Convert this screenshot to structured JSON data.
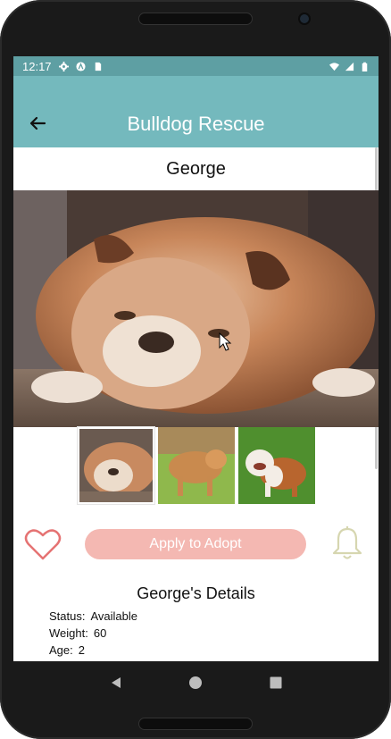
{
  "status_bar": {
    "time": "12:17",
    "left_icons": [
      "gear-icon",
      "a-logo-icon",
      "sim-card-icon"
    ],
    "right_icons": [
      "wifi-icon",
      "signal-icon",
      "battery-icon"
    ]
  },
  "app_bar": {
    "title": "Bulldog Rescue",
    "back_icon": "arrow-left-icon",
    "color": "#74b9bd"
  },
  "dog": {
    "name": "George",
    "photos": [
      "bulldog-lying-photo",
      "bulldog-on-grass-photo",
      "bulldog-standing-photo"
    ],
    "selected_photo_index": 0
  },
  "actions": {
    "favorite_icon": "heart-icon",
    "adopt_label": "Apply to Adopt",
    "notify_icon": "bell-icon",
    "adopt_color": "#f4b8b2",
    "heart_color": "#e57373",
    "bell_color": "#d6d6b0"
  },
  "details": {
    "title": "George's Details",
    "rows": [
      {
        "label": "Status:",
        "value": "Available"
      },
      {
        "label": "Weight:",
        "value": "60"
      },
      {
        "label": "Age:",
        "value": "2"
      }
    ]
  },
  "nav": {
    "back_icon": "nav-back-icon",
    "home_icon": "nav-home-icon",
    "recents_icon": "nav-recents-icon"
  }
}
